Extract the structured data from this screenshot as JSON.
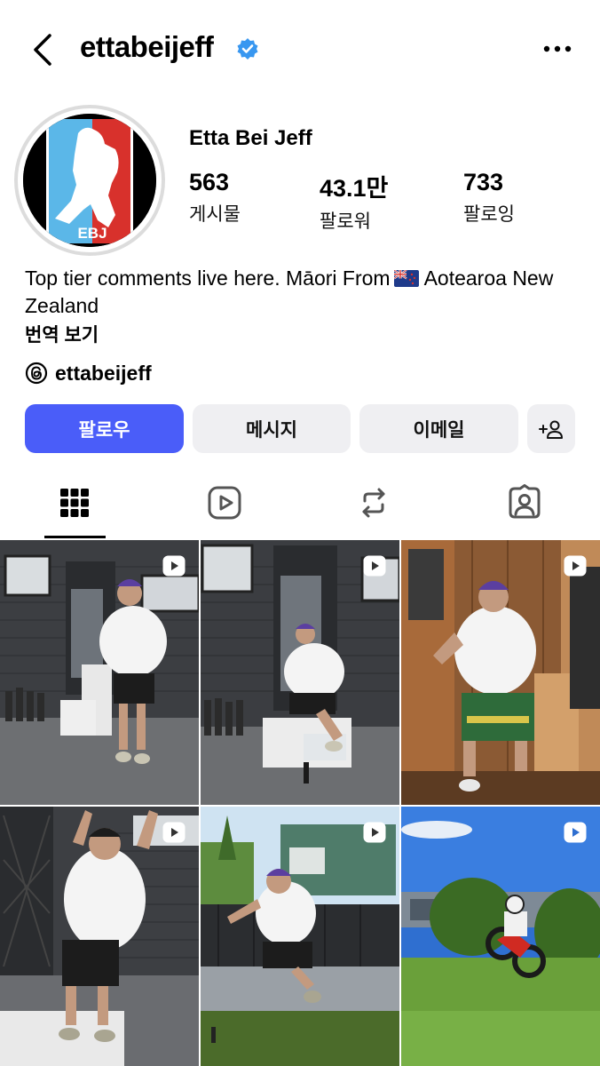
{
  "header": {
    "username": "ettabeijeff",
    "verified": true,
    "back_icon": "chevron-left-icon",
    "more_icon": "more-horizontal-icon"
  },
  "profile": {
    "display_name": "Etta Bei Jeff",
    "avatar_logo_text": "EBJ",
    "stats": [
      {
        "value": "563",
        "label": "게시물"
      },
      {
        "value": "43.1만",
        "label": "팔로워"
      },
      {
        "value": "733",
        "label": "팔로잉"
      }
    ],
    "bio_before_flag": "Top tier comments live here. Māori From",
    "bio_flag": "new-zealand-flag",
    "bio_after_flag": "Aotearoa New Zealand",
    "translate_label": "번역 보기",
    "threads_handle": "ettabeijeff"
  },
  "actions": {
    "follow": "팔로우",
    "message": "메시지",
    "email": "이메일",
    "suggest_icon": "add-person-icon"
  },
  "tabs": [
    {
      "icon": "grid-icon",
      "active": true
    },
    {
      "icon": "reels-icon",
      "active": false
    },
    {
      "icon": "reposts-icon",
      "active": false
    },
    {
      "icon": "tagged-icon",
      "active": false
    }
  ],
  "colors": {
    "follow_button": "#4a5df9",
    "secondary_button": "#efeff2",
    "verified_badge": "#3897f0"
  },
  "posts": [
    {
      "type": "reel",
      "scene": "man in white shirt and purple cap at doorstep"
    },
    {
      "type": "reel",
      "scene": "man sitting on doorstep steps"
    },
    {
      "type": "reel",
      "scene": "man leaning on wooden door indoors"
    },
    {
      "type": "reel",
      "scene": "man jumping with arms raised"
    },
    {
      "type": "reel",
      "scene": "man mid-air in yard"
    },
    {
      "type": "reel",
      "scene": "rider on red dirt bike on lawn"
    }
  ]
}
